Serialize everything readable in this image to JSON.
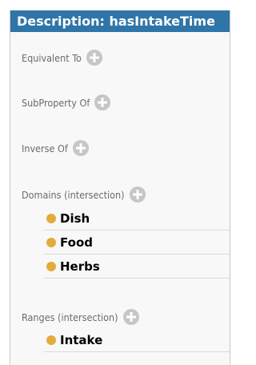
{
  "title": "Description: hasIntakeTime",
  "colors": {
    "title_bg": "#2f75a8",
    "add_button": "#c6c6c6",
    "class_dot": "#e3ab3c"
  },
  "sections": {
    "equivalent_to": {
      "label": "Equivalent To",
      "icon": "plus-circle-icon"
    },
    "subproperty_of": {
      "label": "SubProperty Of",
      "icon": "plus-circle-icon"
    },
    "inverse_of": {
      "label": "Inverse Of",
      "icon": "plus-circle-icon"
    },
    "domains": {
      "label": "Domains (intersection)",
      "icon": "plus-circle-icon",
      "items": [
        "Dish",
        "Food",
        "Herbs"
      ]
    },
    "ranges": {
      "label": "Ranges (intersection)",
      "icon": "plus-circle-icon",
      "items": [
        "Intake"
      ]
    }
  }
}
